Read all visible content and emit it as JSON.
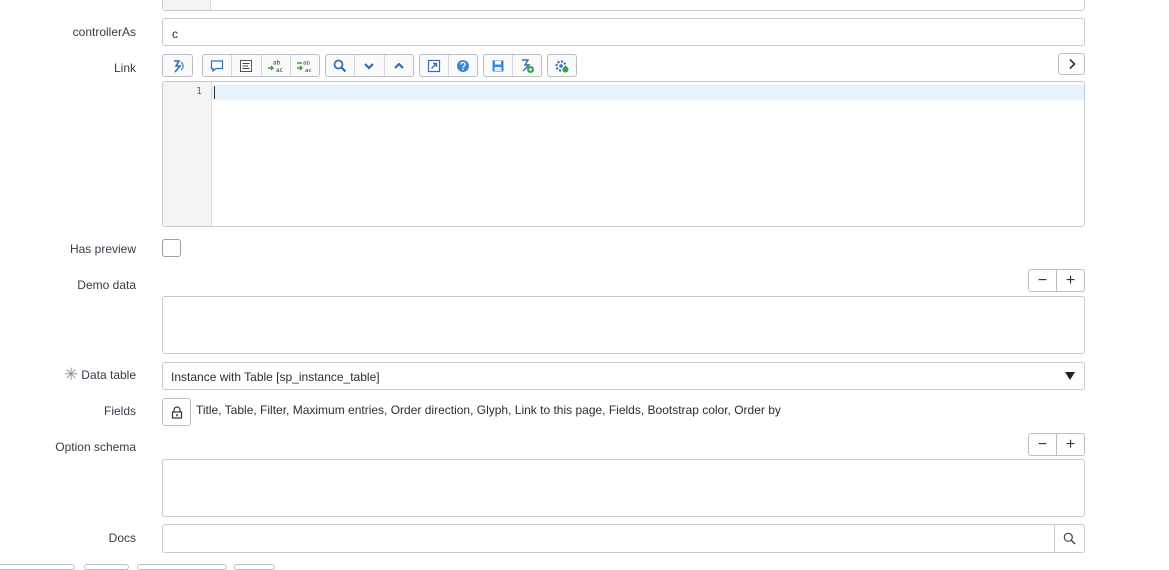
{
  "form": {
    "controllerAs": {
      "label": "controllerAs",
      "value": "c"
    },
    "link": {
      "label": "Link",
      "line_numbers": [
        "1"
      ],
      "toolbar_icons": [
        "format-icon",
        "comment-icon",
        "format-code-icon",
        "replace-icon",
        "replace-all-icon",
        "search-icon",
        "fold-down-icon",
        "fold-up-icon",
        "fullscreen-icon",
        "help-icon",
        "save-icon",
        "script-debug-icon",
        "settings-icon"
      ],
      "expand_icon": "chevron-right-icon"
    },
    "has_preview": {
      "label": "Has preview",
      "checked": false
    },
    "demo_data": {
      "label": "Demo data",
      "value": ""
    },
    "data_table": {
      "label": "Data table",
      "value": "Instance with Table [sp_instance_table]",
      "required": true
    },
    "fields": {
      "label": "Fields",
      "value": "Title, Table, Filter, Maximum entries, Order direction, Glyph, Link to this page, Fields, Bootstrap color, Order by"
    },
    "option_schema": {
      "label": "Option schema",
      "value": ""
    },
    "docs": {
      "label": "Docs",
      "value": ""
    }
  },
  "colors": {
    "accent_blue": "#2f6fb4",
    "green": "#3aa53a",
    "border": "#c8cbce",
    "active_line": "#e8f2fc"
  }
}
